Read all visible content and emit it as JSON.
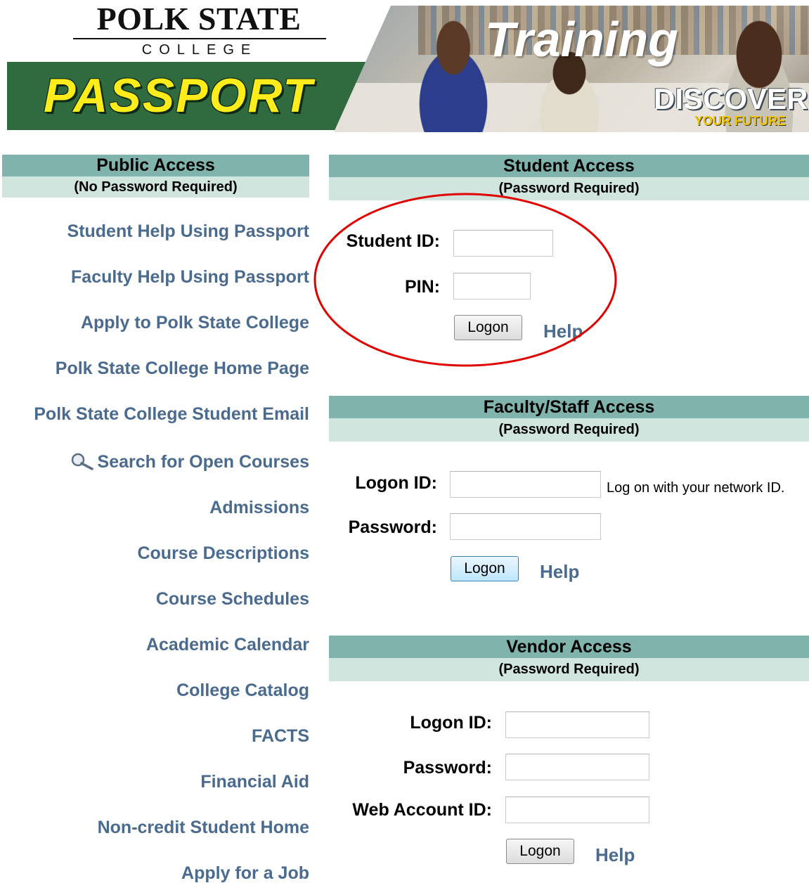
{
  "banner": {
    "college_name": "POLK STATE",
    "college_sub": "COLLEGE",
    "app_name": "PASSPORT",
    "training": "Training",
    "discover": "DISCOVER",
    "your_future": "YOUR FUTURE"
  },
  "public_access": {
    "title": "Public Access",
    "subtitle": "(No Password Required)",
    "links": [
      "Student Help Using Passport",
      "Faculty Help Using Passport",
      "Apply to Polk State College",
      "Polk State College Home Page",
      "Polk State College Student Email",
      "Search for Open Courses",
      "Admissions",
      "Course Descriptions",
      "Course Schedules",
      "Academic Calendar",
      "College Catalog",
      "FACTS",
      "Financial Aid",
      "Non-credit Student Home",
      "Apply for a Job"
    ],
    "search_icon": "magnifier-icon"
  },
  "student_access": {
    "title": "Student Access",
    "subtitle": "(Password Required)",
    "id_label": "Student ID:",
    "id_value": "",
    "pin_label": "PIN:",
    "pin_value": "",
    "logon_label": "Logon",
    "help_label": "Help",
    "highlight_color": "#e00000"
  },
  "faculty_access": {
    "title": "Faculty/Staff Access",
    "subtitle": "(Password Required)",
    "id_label": "Logon ID:",
    "id_value": "",
    "id_note": "Log on with your network ID.",
    "password_label": "Password:",
    "password_value": "",
    "logon_label": "Logon",
    "help_label": "Help"
  },
  "vendor_access": {
    "title": "Vendor Access",
    "subtitle": "(Password Required)",
    "id_label": "Logon ID:",
    "id_value": "",
    "password_label": "Password:",
    "password_value": "",
    "web_account_label": "Web Account ID:",
    "web_account_value": "",
    "logon_label": "Logon",
    "help_label": "Help"
  },
  "colors": {
    "header_dark": "#7fb3ab",
    "header_light": "#cfe5de",
    "link": "#4a6a8e",
    "banner_green": "#2f6b3f",
    "passport_yellow": "#ffec1a"
  }
}
